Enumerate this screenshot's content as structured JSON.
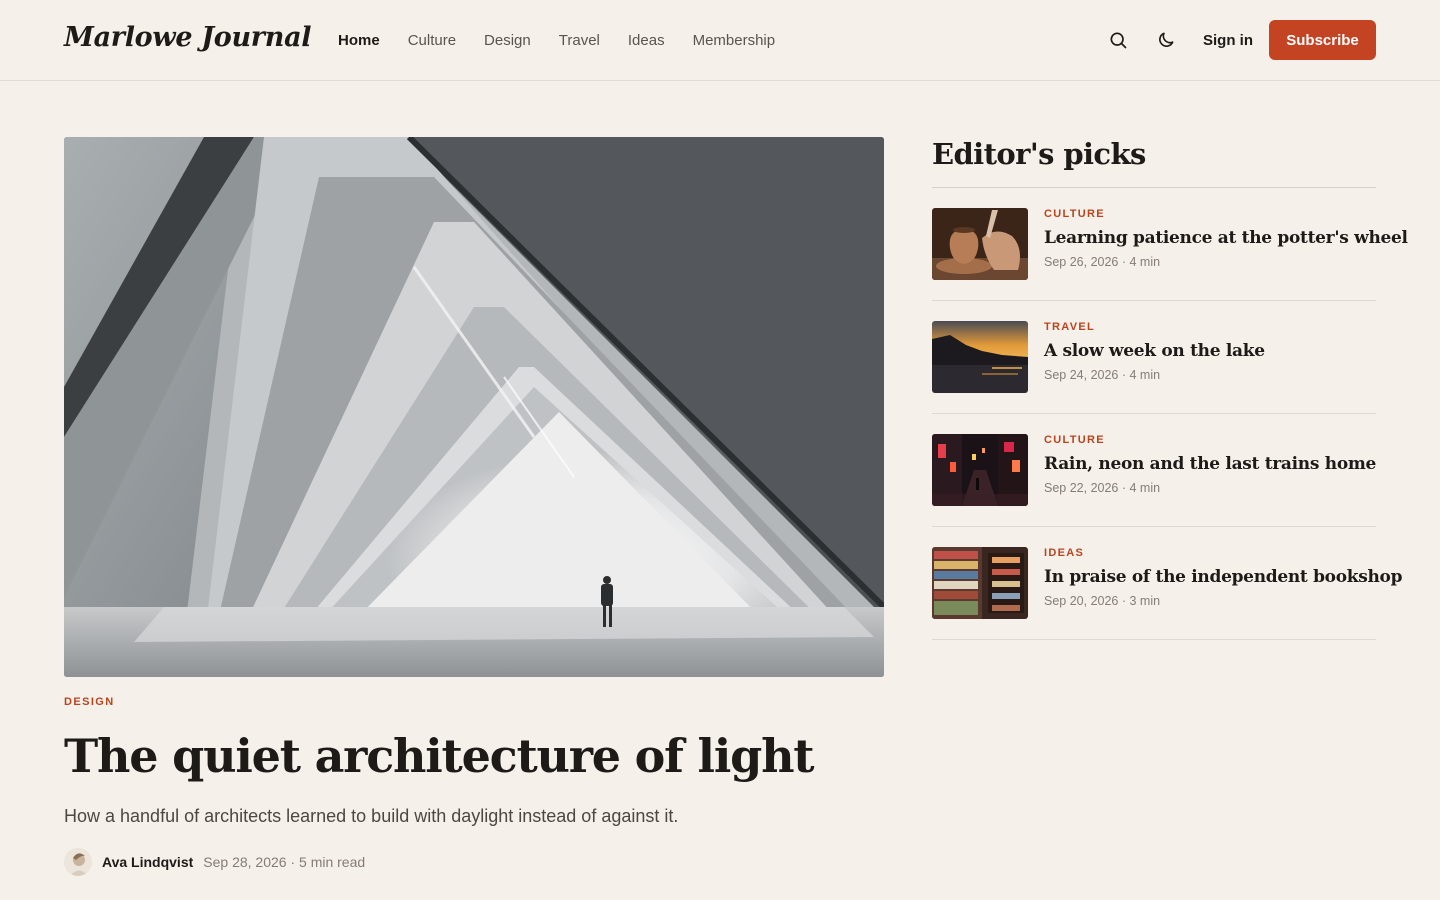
{
  "header": {
    "logo": "Marlowe Journal",
    "nav": [
      "Home",
      "Culture",
      "Design",
      "Travel",
      "Ideas",
      "Membership"
    ],
    "active_nav": "Home",
    "search_icon": "search-icon",
    "theme_icon": "moon-icon",
    "signin_label": "Sign in",
    "subscribe_label": "Subscribe"
  },
  "hero": {
    "category": "DESIGN",
    "title": "The quiet architecture of light",
    "subtitle": "How a handful of architects learned to build with daylight instead of against it.",
    "author": "Ava Lindqvist",
    "meta": "Sep 28, 2026 · 5 min read"
  },
  "sidebar": {
    "title": "Editor's picks",
    "items": [
      {
        "category": "CULTURE",
        "title": "Learning patience at the potter's wheel",
        "meta": "Sep 26, 2026 · 4 min"
      },
      {
        "category": "TRAVEL",
        "title": "A slow week on the lake",
        "meta": "Sep 24, 2026 · 4 min"
      },
      {
        "category": "CULTURE",
        "title": "Rain, neon and the last trains home",
        "meta": "Sep 22, 2026 · 4 min"
      },
      {
        "category": "IDEAS",
        "title": "In praise of the independent bookshop",
        "meta": "Sep 20, 2026 · 3 min"
      }
    ]
  },
  "colors": {
    "background": "#f6f0ea",
    "accent": "#c44322",
    "category": "#b8451f",
    "text": "#1d1a17"
  }
}
